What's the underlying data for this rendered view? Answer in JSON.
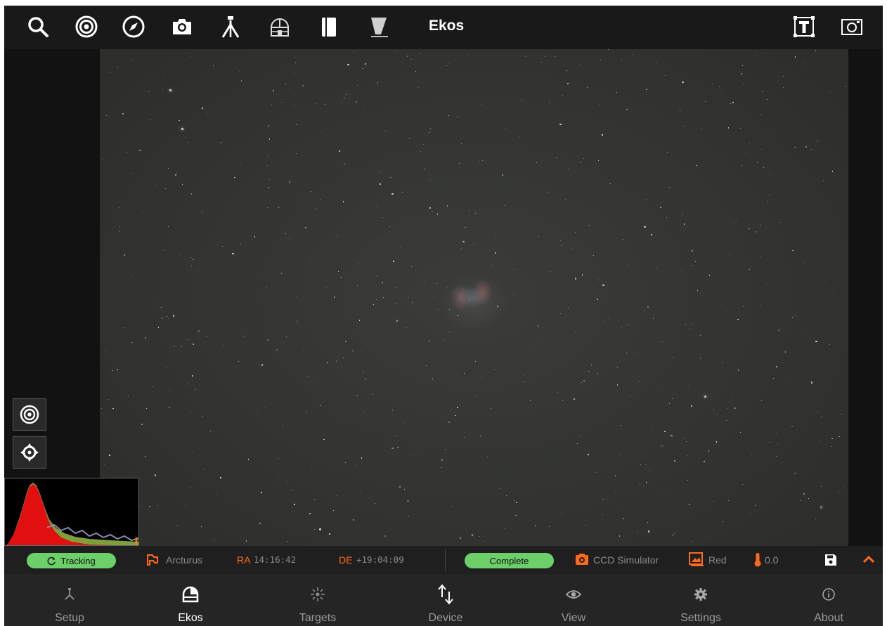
{
  "topbar": {
    "title": "Ekos",
    "icons": [
      "search-icon",
      "target-icon",
      "compass-icon",
      "camera-icon",
      "tripod-icon",
      "observatory-dome-icon",
      "filter-book-icon",
      "flat-panel-icon",
      "text-overlay-icon",
      "frame-icon"
    ]
  },
  "status": {
    "tracking_label": "Tracking",
    "target_name": "Arcturus",
    "ra_label": "RA",
    "ra_value": "14:16:42",
    "de_label": "DE",
    "de_value": "+19:04:09",
    "capture_status": "Complete",
    "camera_name": "CCD Simulator",
    "filter_name": "Red",
    "temperature": "0.0"
  },
  "nav": {
    "items": [
      {
        "label": "Setup",
        "icon": "setup-icon"
      },
      {
        "label": "Ekos",
        "icon": "ekos-dome-icon",
        "active": true
      },
      {
        "label": "Targets",
        "icon": "targets-icon"
      },
      {
        "label": "Device",
        "icon": "device-arrows-icon"
      },
      {
        "label": "View",
        "icon": "eye-icon"
      },
      {
        "label": "Settings",
        "icon": "gear-icon"
      },
      {
        "label": "About",
        "icon": "info-icon"
      }
    ]
  },
  "colors": {
    "accent": "#ff6a1a",
    "status_green": "#6ccf6a",
    "background": "#191919"
  }
}
